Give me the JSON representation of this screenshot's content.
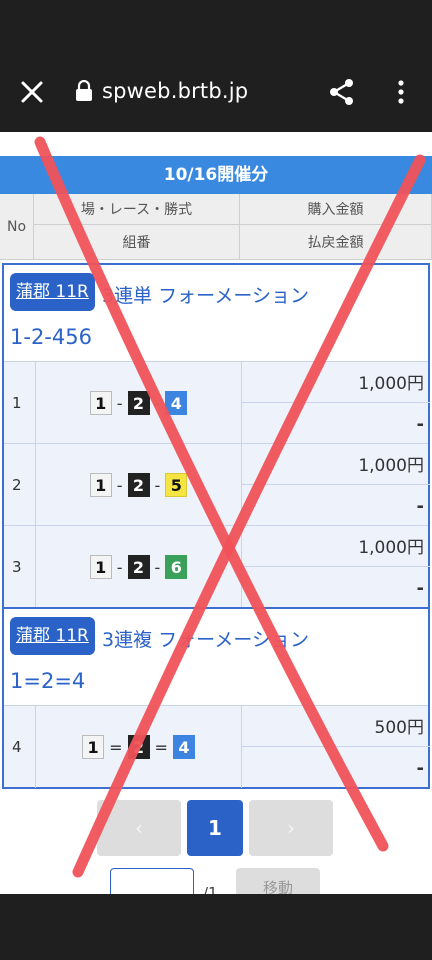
{
  "browser": {
    "url": "spweb.brtb.jp"
  },
  "page": {
    "date_header": "10/16開催分",
    "columns": {
      "no": "No",
      "race": "場・レース・勝式",
      "combination": "組番",
      "purchase": "購入金額",
      "payout": "払戻金額"
    },
    "groups": [
      {
        "badge": "蒲郡 11R",
        "bet_type": "3連単 フォーメーション",
        "combo": "1-2-456",
        "rows": [
          {
            "no": "1",
            "boats": [
              "1",
              "2",
              "4"
            ],
            "separators": [
              "-",
              "-"
            ],
            "purchase": "1,000円",
            "payout": "-"
          },
          {
            "no": "2",
            "boats": [
              "1",
              "2",
              "5"
            ],
            "separators": [
              "-",
              "-"
            ],
            "purchase": "1,000円",
            "payout": "-"
          },
          {
            "no": "3",
            "boats": [
              "1",
              "2",
              "6"
            ],
            "separators": [
              "-",
              "-"
            ],
            "purchase": "1,000円",
            "payout": "-"
          }
        ]
      },
      {
        "badge": "蒲郡 11R",
        "bet_type": "3連複 フォーメーション",
        "combo": "1=2=4",
        "rows": [
          {
            "no": "4",
            "boats": [
              "1",
              "2",
              "4"
            ],
            "separators": [
              "=",
              "="
            ],
            "purchase": "500円",
            "payout": "-"
          }
        ]
      }
    ],
    "pagination": {
      "prev": "‹",
      "current": "1",
      "next": "›",
      "total": "/1",
      "move_label": "移動"
    }
  },
  "icons": {
    "close": "close-icon",
    "lock": "lock-icon",
    "share": "share-icon",
    "more": "more-vert-icon"
  },
  "colors": {
    "header_blue": "#3a89e0",
    "accent_blue": "#2a62c8",
    "overlay_red": "#f0525a"
  }
}
